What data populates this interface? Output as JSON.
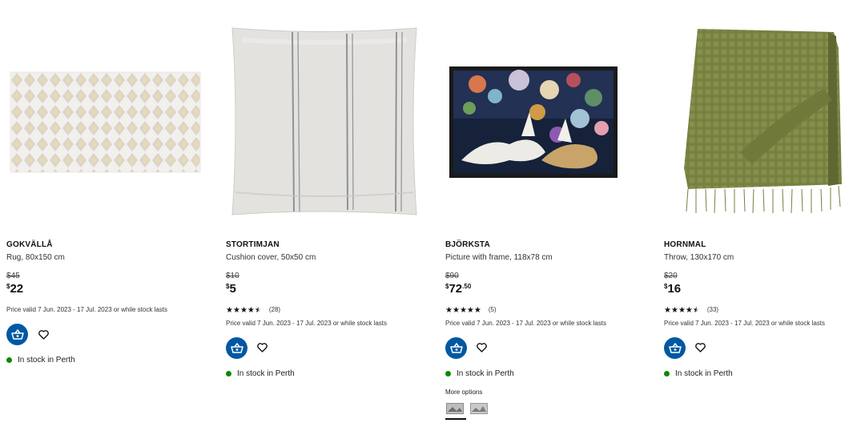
{
  "products": [
    {
      "name": "GOKVÄLLÅ",
      "description": "Rug, 80x150 cm",
      "old_price": "$45",
      "price_currency": "$",
      "price_int": "22",
      "price_dec": "",
      "rating_stars": 0,
      "rating_count": "",
      "validity": "Price valid 7 Jun. 2023 - 17 Jul. 2023 or while stock lasts",
      "stock": "In stock in Perth"
    },
    {
      "name": "STORTIMJAN",
      "description": "Cushion cover, 50x50 cm",
      "old_price": "$10",
      "price_currency": "$",
      "price_int": "5",
      "price_dec": "",
      "rating_stars": 4.5,
      "rating_count": "(28)",
      "validity": "Price valid 7 Jun. 2023 - 17 Jul. 2023 or while stock lasts",
      "stock": "In stock in Perth"
    },
    {
      "name": "BJÖRKSTA",
      "description": "Picture with frame, 118x78 cm",
      "old_price": "$90",
      "price_currency": "$",
      "price_int": "72",
      "price_dec": ".50",
      "rating_stars": 5,
      "rating_count": "(5)",
      "validity": "Price valid 7 Jun. 2023 - 17 Jul. 2023 or while stock lasts",
      "stock": "In stock in Perth",
      "more_options": "More options"
    },
    {
      "name": "HORNMAL",
      "description": "Throw, 130x170 cm",
      "old_price": "$20",
      "price_currency": "$",
      "price_int": "16",
      "price_dec": "",
      "rating_stars": 4.5,
      "rating_count": "(33)",
      "validity": "Price valid 7 Jun. 2023 - 17 Jul. 2023 or while stock lasts",
      "stock": "In stock in Perth"
    }
  ],
  "icons": {
    "cart": "add-to-cart-icon",
    "favourite": "heart-icon",
    "stock": "stock-status-dot",
    "star": "star-icon"
  },
  "colors": {
    "cart_button": "#0058a3",
    "in_stock": "#0a8a00"
  }
}
